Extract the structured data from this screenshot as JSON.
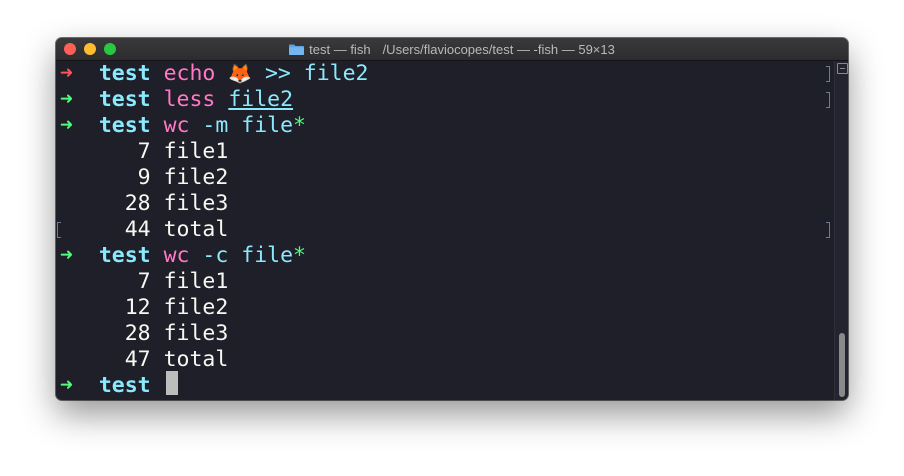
{
  "window": {
    "title_left": "test — fish",
    "title_right": "/Users/flaviocopes/test — -fish — 59×13",
    "folder_icon": "folder-icon",
    "accent_colors": {
      "prompt_arrow": "#50fa7b",
      "prompt_arrow_error": "#ff5555",
      "directory": "#8be9fd",
      "command": "#ff79c6",
      "background": "#1e1f28"
    }
  },
  "prompt": {
    "arrow": "➜",
    "dir": "test"
  },
  "lines": {
    "l0": {
      "cmd": "echo",
      "emoji": "🦊",
      "op": ">>",
      "arg": "file2"
    },
    "l1": {
      "cmd": "less",
      "arg": "file2"
    },
    "l2": {
      "cmd": "wc",
      "flag": "-m",
      "arg": "file",
      "glob": "*"
    },
    "l3": {
      "count": "7",
      "name": "file1"
    },
    "l4": {
      "count": "9",
      "name": "file2"
    },
    "l5": {
      "count": "28",
      "name": "file3"
    },
    "l6": {
      "count": "44",
      "name": "total"
    },
    "l7": {
      "cmd": "wc",
      "flag": "-c",
      "arg": "file",
      "glob": "*"
    },
    "l8": {
      "count": "7",
      "name": "file1"
    },
    "l9": {
      "count": "12",
      "name": "file2"
    },
    "l10": {
      "count": "28",
      "name": "file3"
    },
    "l11": {
      "count": "47",
      "name": "total"
    }
  }
}
